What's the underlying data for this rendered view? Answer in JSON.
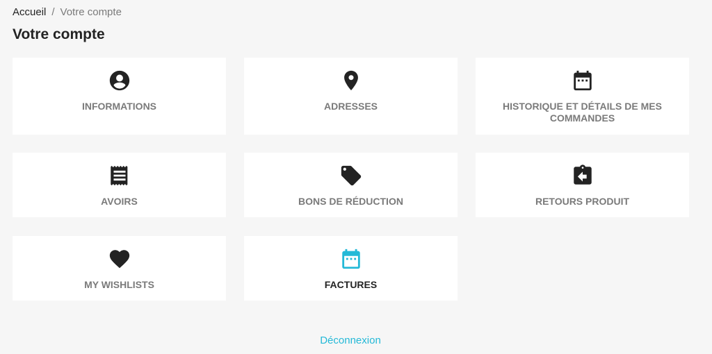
{
  "breadcrumb": {
    "home": "Accueil",
    "separator": "/",
    "current": "Votre compte"
  },
  "page_title": "Votre compte",
  "tiles": [
    {
      "label": "Informations",
      "icon": "account-circle-icon"
    },
    {
      "label": "Adresses",
      "icon": "map-pin-icon"
    },
    {
      "label": "Historique et détails de mes commandes",
      "icon": "calendar-icon"
    },
    {
      "label": "Avoirs",
      "icon": "receipt-icon"
    },
    {
      "label": "Bons de réduction",
      "icon": "tag-icon"
    },
    {
      "label": "Retours produit",
      "icon": "clipboard-return-icon"
    },
    {
      "label": "My wishlists",
      "icon": "heart-icon"
    },
    {
      "label": "Factures",
      "icon": "calendar-icon",
      "active": true
    }
  ],
  "logout_label": "Déconnexion",
  "colors": {
    "accent": "#24b9d7",
    "text_dark": "#232323",
    "text_muted": "#7a7a7a",
    "background": "#f6f6f6",
    "card": "#ffffff"
  }
}
